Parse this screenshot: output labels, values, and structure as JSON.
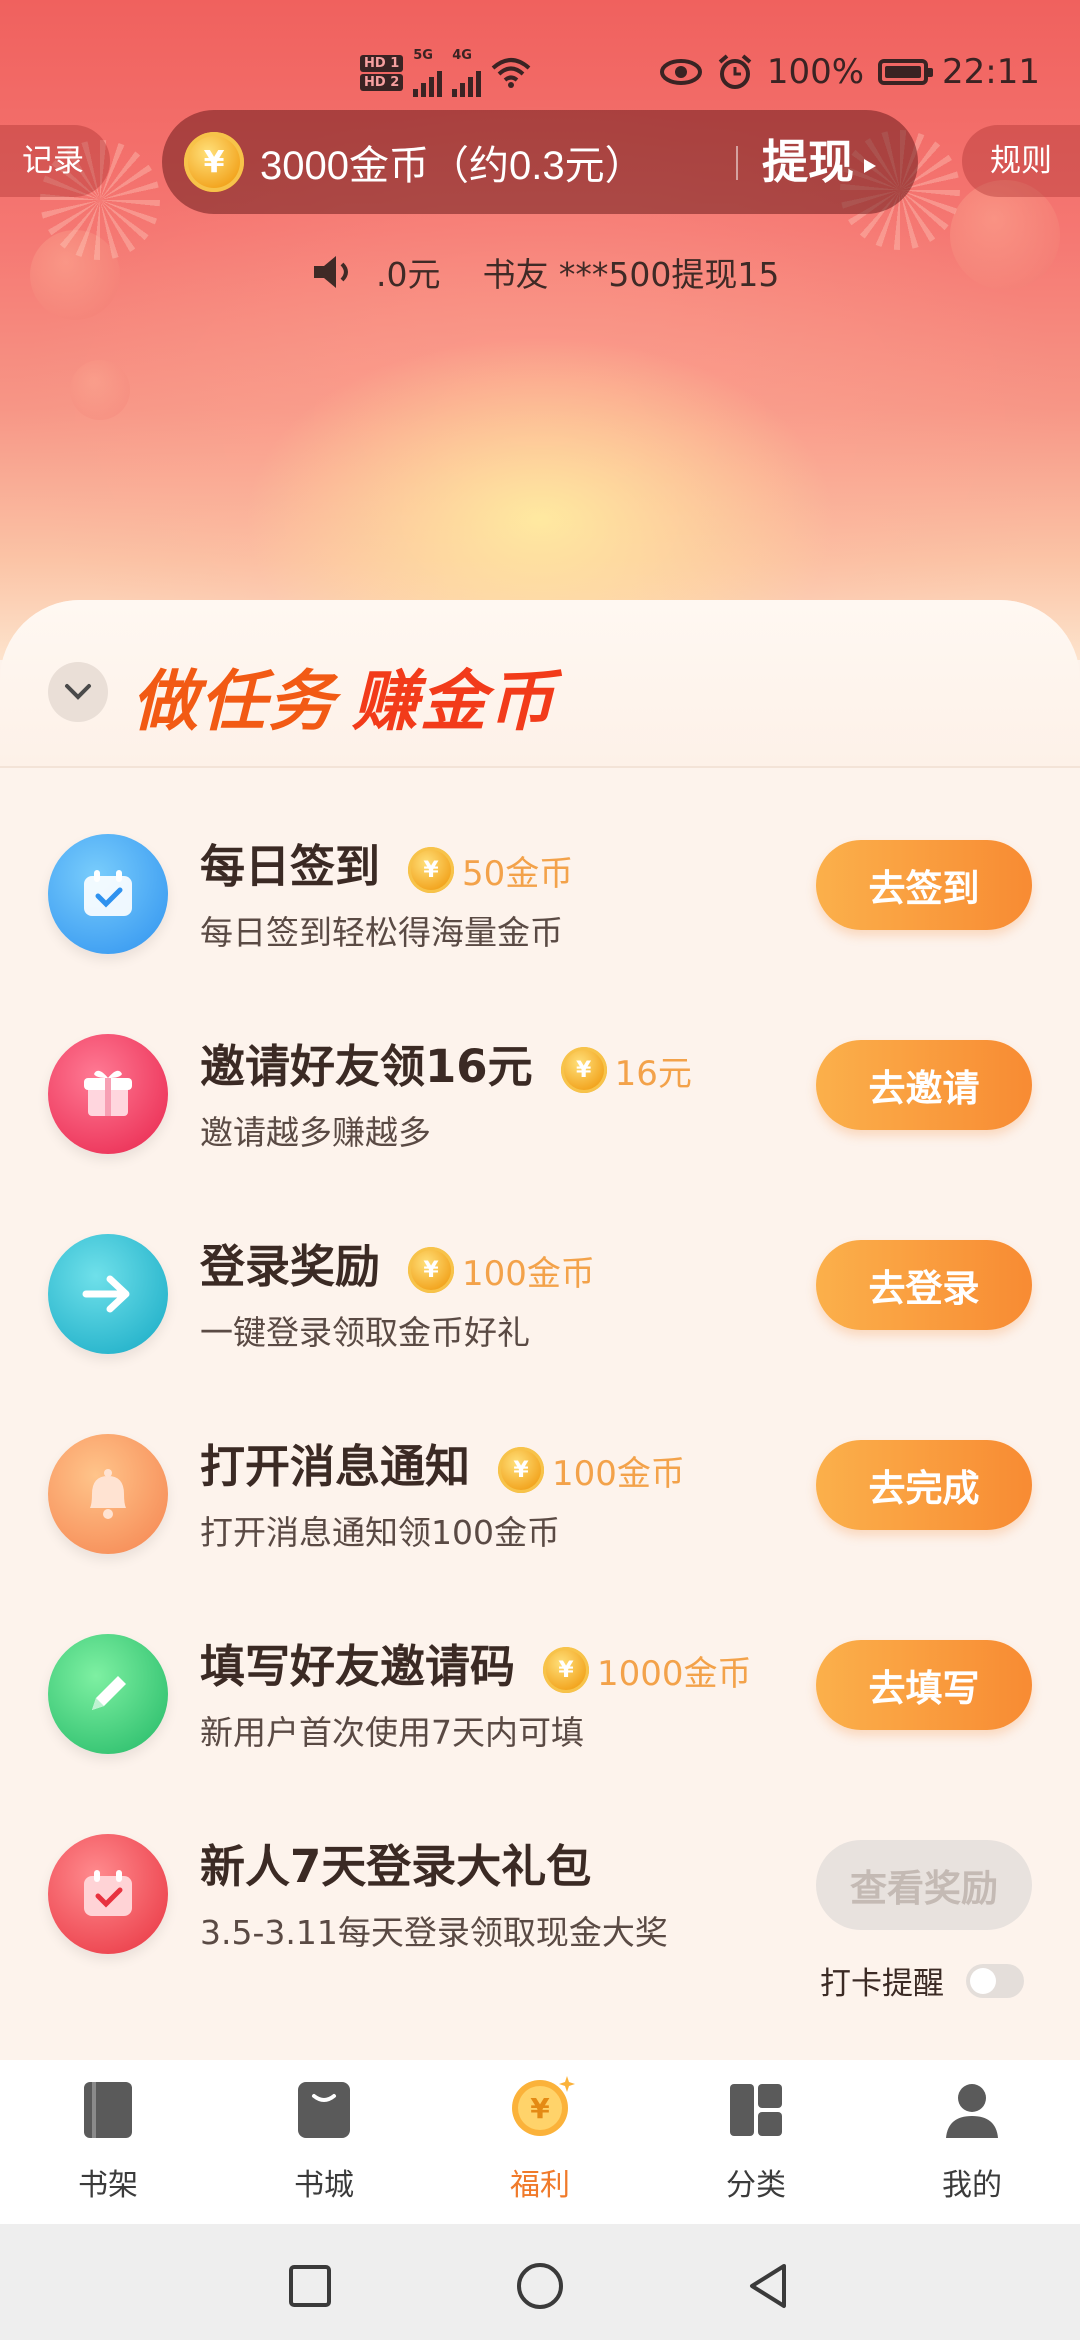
{
  "status_bar": {
    "hd1": "HD 1",
    "hd2": "HD 2",
    "net1": "5G",
    "net2": "4G",
    "battery": "100%",
    "time": "22:11"
  },
  "header": {
    "records_label": "记录",
    "rules_label": "规则",
    "coin_balance": "3000金币（约0.3元）",
    "withdraw_label": "提现",
    "ticker_text": ".0元    书友 ***500提现15"
  },
  "section": {
    "title_part1": "做任务",
    "title_part2": "赚金币"
  },
  "tasks": [
    {
      "title": "每日签到",
      "reward": "50金币",
      "desc": "每日签到轻松得海量金币",
      "button": "去签到",
      "icon": "calendar-check-icon",
      "color": "#3aa8f2"
    },
    {
      "title": "邀请好友领16元",
      "reward": "16元",
      "desc": "邀请越多赚越多",
      "button": "去邀请",
      "icon": "gift-icon",
      "color": "#f23d5e"
    },
    {
      "title": "登录奖励",
      "reward": "100金币",
      "desc": "一键登录领取金币好礼",
      "button": "去登录",
      "icon": "arrow-right-icon",
      "color": "#1fbfcf"
    },
    {
      "title": "打开消息通知",
      "reward": "100金币",
      "desc": "打开消息通知领100金币",
      "button": "去完成",
      "icon": "bell-icon",
      "color": "#f7955a"
    },
    {
      "title": "填写好友邀请码",
      "reward": "1000金币",
      "desc": "新用户首次使用7天内可填",
      "button": "去填写",
      "icon": "pencil-icon",
      "color": "#3ccf74"
    },
    {
      "title": "新人7天登录大礼包",
      "reward": "",
      "desc": "3.5-3.11每天登录领取现金大奖",
      "button": "查看奖励",
      "icon": "calendar-gift-icon",
      "color": "#f04c5a",
      "button_disabled": true,
      "remind_label": "打卡提醒",
      "remind_on": false
    }
  ],
  "tabs": [
    {
      "label": "书架",
      "icon": "bookshelf-icon",
      "active": false
    },
    {
      "label": "书城",
      "icon": "bookstore-icon",
      "active": false
    },
    {
      "label": "福利",
      "icon": "coin-icon",
      "active": true
    },
    {
      "label": "分类",
      "icon": "category-grid-icon",
      "active": false
    },
    {
      "label": "我的",
      "icon": "profile-icon",
      "active": false
    }
  ],
  "coin_symbol": "¥"
}
